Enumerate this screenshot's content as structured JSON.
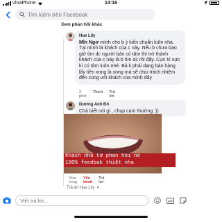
{
  "status_bar": {
    "carrier": "VinaPhone",
    "time": "14:16"
  },
  "search": {
    "placeholder": "Tìm kiếm trên Facebook"
  },
  "older_link": "Xem phản hồi khác",
  "comment1": {
    "author": "Hue Lily",
    "tag": "Mĩn Ngơ",
    "text": " mình cho b ý kiến chuẩn luôn nha. Tại mình là khách của c này. Nếu b chưa bao giờ tìm dc người bán có tâm thì trở thành khách của c này là b tìm dc rồi đấy. Cực kì cực kì có tâm luôn nhé. Bả k phải dạng bán hàng lấy tiền xong là xong mà sẽ chịu trách nhiệm đến cùng với khách của mình đấy",
    "time": "2 phút",
    "like": "Thích",
    "reply": "Trả lời"
  },
  "comment2": {
    "author": "Dương Anh Đô",
    "text": "Chả biết nói gì , chụp cam thường :))",
    "caption_line1": "Khách nhà tớ phản hồi nè",
    "caption_line2": "100% feedbak thiệt nha",
    "time": "Vừa xong",
    "like": "Yêu thích",
    "reply": "Trả lời"
  },
  "reply_to": "Trả lời Hue Lily",
  "composer": {
    "placeholder": "Viết trả lời..."
  },
  "colors": {
    "accent": "#1877f2",
    "caption_bg": "#b41f24",
    "love": "#d52c2c"
  }
}
